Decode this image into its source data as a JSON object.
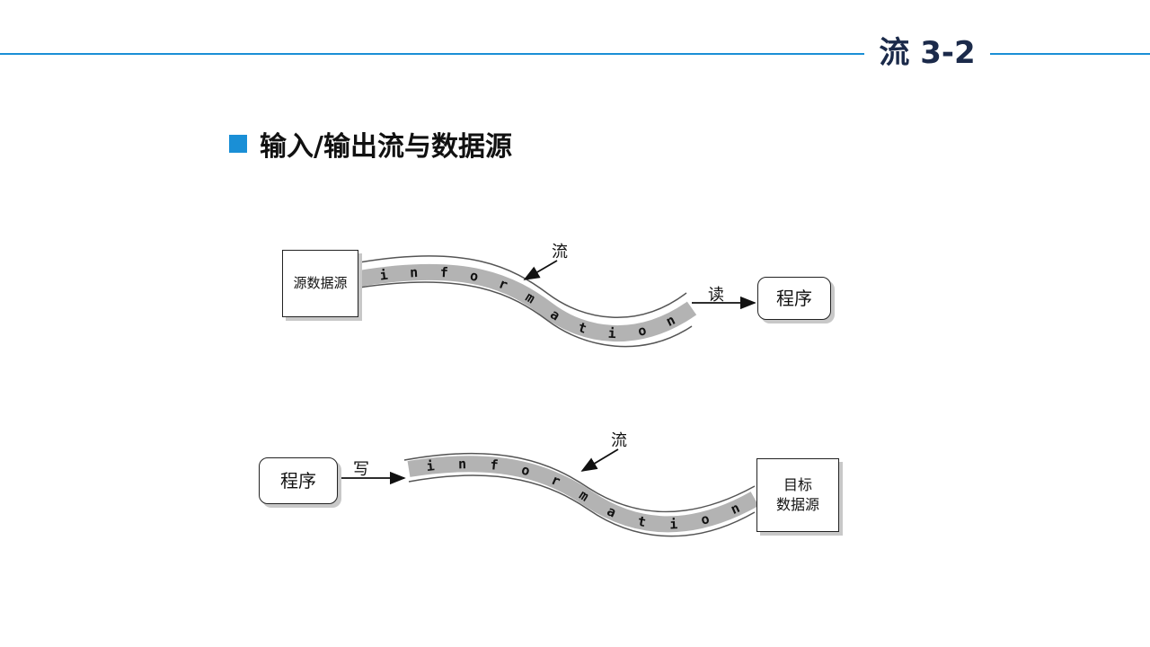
{
  "slide": {
    "title": "流 3-2"
  },
  "heading": {
    "text": "输入/输出流与数据源"
  },
  "input_flow": {
    "source_box": "源数据源",
    "stream_label": "流",
    "action_label": "读",
    "target_box": "程序",
    "stream_letters": [
      "i",
      "n",
      "f",
      "o",
      "r",
      "m",
      "a",
      "t",
      "i",
      "o",
      "n"
    ]
  },
  "output_flow": {
    "source_box": "程序",
    "action_label": "写",
    "stream_label": "流",
    "target_box": "目标\n数据源",
    "stream_letters": [
      "i",
      "n",
      "f",
      "o",
      "r",
      "m",
      "a",
      "t",
      "i",
      "o",
      "n"
    ]
  },
  "colors": {
    "accent": "#1a8fd6",
    "title": "#1b2a4a",
    "band": "#b3b3b3"
  }
}
